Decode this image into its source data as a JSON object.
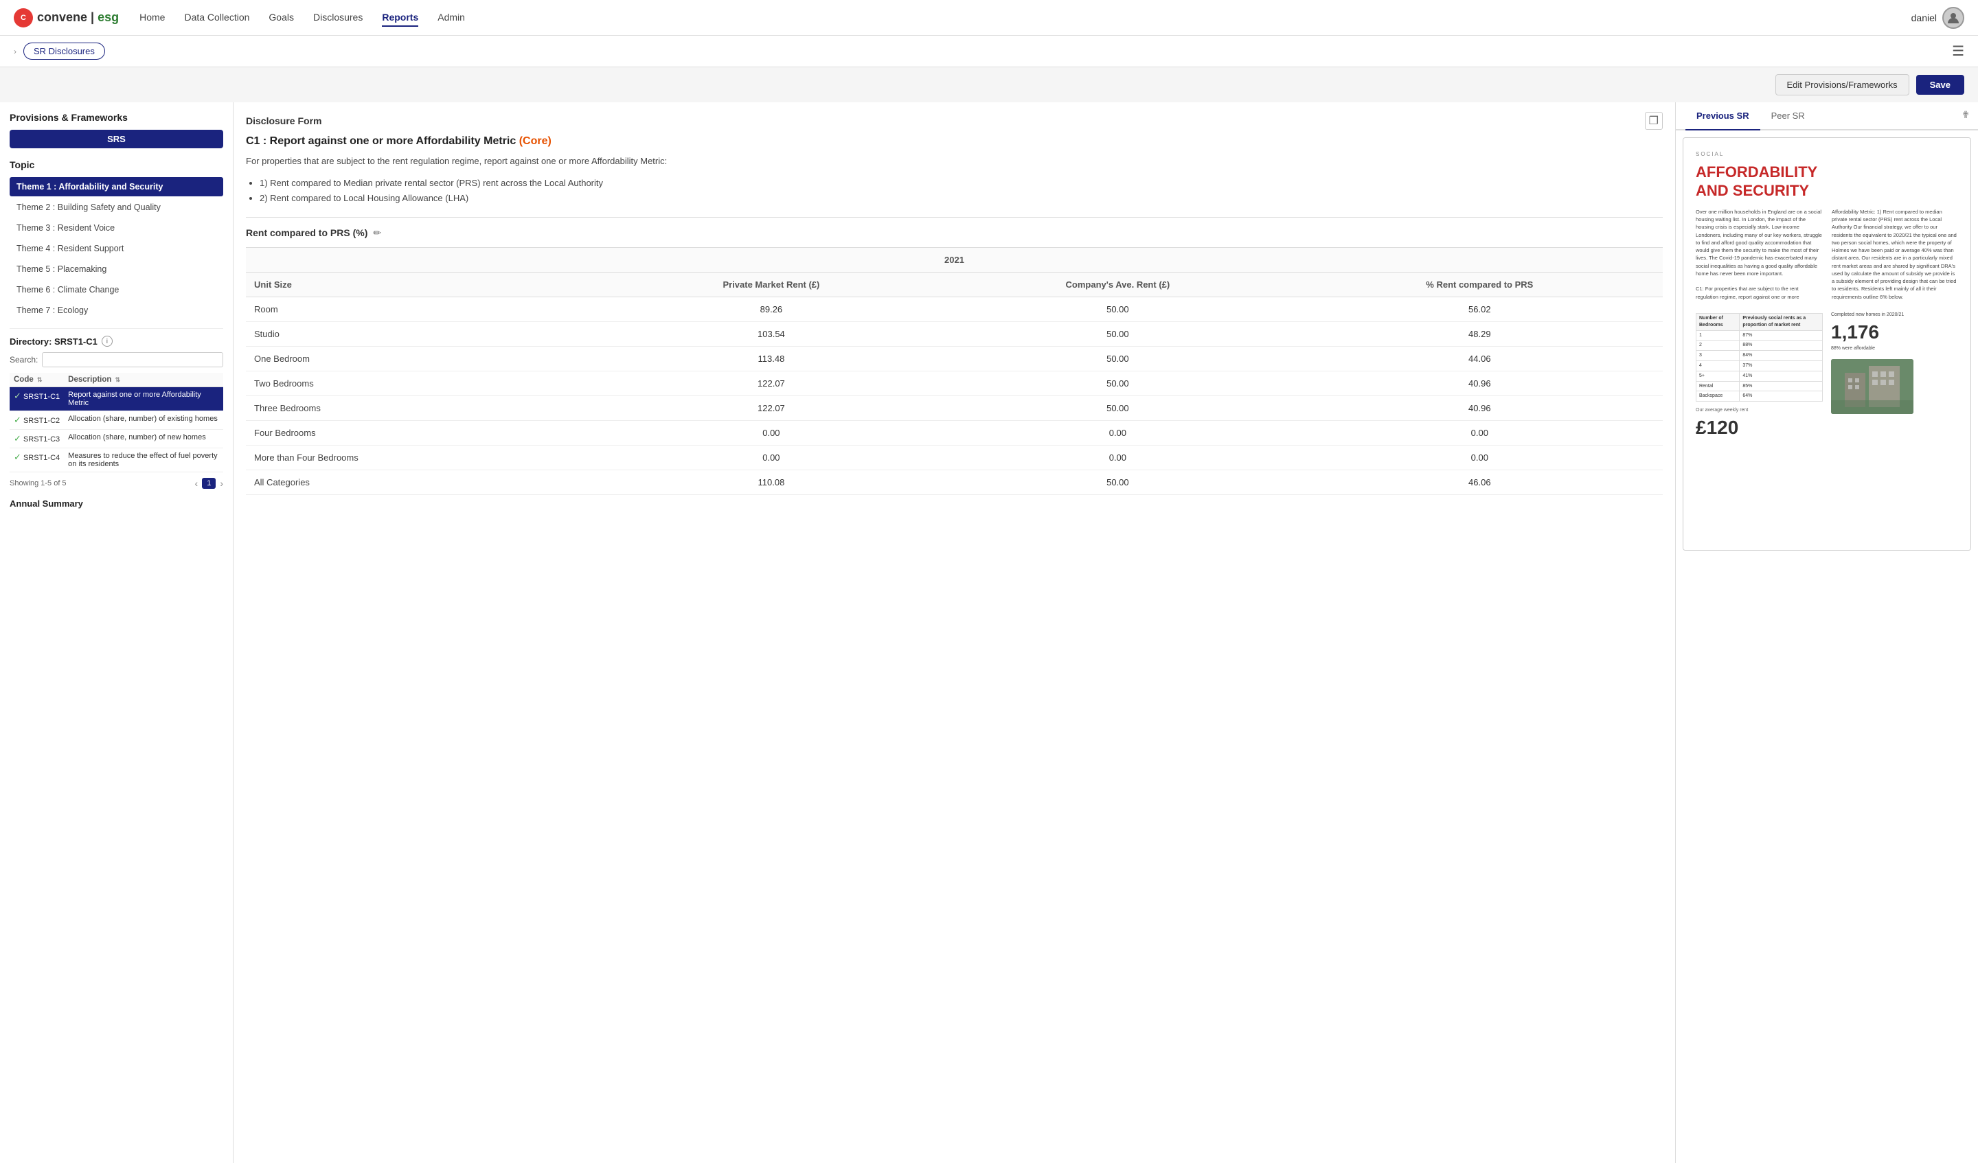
{
  "navbar": {
    "logo_brand": "convene",
    "logo_esg": "esg",
    "links": [
      "Home",
      "Data Collection",
      "Goals",
      "Disclosures",
      "Reports",
      "Admin"
    ],
    "active_link": "Reports",
    "user_name": "daniel"
  },
  "breadcrumb": {
    "label": "SR Disclosures"
  },
  "actions": {
    "edit_label": "Edit Provisions/Frameworks",
    "save_label": "Save"
  },
  "left_panel": {
    "provisions_title": "Provisions & Frameworks",
    "framework_badge": "SRS",
    "topic_title": "Topic",
    "topics": [
      {
        "label": "Theme 1 : Affordability and Security",
        "active": true
      },
      {
        "label": "Theme 2 : Building Safety and Quality",
        "active": false
      },
      {
        "label": "Theme 3 : Resident Voice",
        "active": false
      },
      {
        "label": "Theme 4 : Resident Support",
        "active": false
      },
      {
        "label": "Theme 5 : Placemaking",
        "active": false
      },
      {
        "label": "Theme 6 : Climate Change",
        "active": false
      },
      {
        "label": "Theme 7 : Ecology",
        "active": false
      }
    ],
    "directory_title": "Directory: SRST1-C1",
    "search_label": "Search:",
    "search_placeholder": "",
    "dir_col_code": "Code",
    "dir_col_desc": "Description",
    "dir_rows": [
      {
        "code": "SRST1-C1",
        "desc": "Report against one or more Affordability Metric",
        "active": true
      },
      {
        "code": "SRST1-C2",
        "desc": "Allocation (share, number) of existing homes",
        "active": false
      },
      {
        "code": "SRST1-C3",
        "desc": "Allocation (share, number) of new homes",
        "active": false
      },
      {
        "code": "SRST1-C4",
        "desc": "Measures to reduce the effect of fuel poverty on its residents",
        "active": false
      }
    ],
    "pagination_text": "Showing 1-5 of 5",
    "page_num": "1",
    "annual_summary": "Annual Summary"
  },
  "center_panel": {
    "form_title": "Disclosure Form",
    "metric_code": "C1 : Report against one or more Affordability Metric",
    "metric_core_label": "(Core)",
    "description": "For properties that are subject to the rent regulation regime, report against one or more Affordability Metric:",
    "bullets": [
      "1) Rent compared to Median private rental sector (PRS) rent across the Local Authority",
      "2) Rent compared to Local Housing Allowance (LHA)"
    ],
    "section_title": "Rent compared to PRS (%)",
    "year_header": "2021",
    "table_cols": [
      "Unit Size",
      "Private Market Rent (£)",
      "Company's Ave. Rent (£)",
      "% Rent compared to PRS"
    ],
    "table_rows": [
      {
        "unit": "Room",
        "pmr": "89.26",
        "car": "50.00",
        "pct": "56.02"
      },
      {
        "unit": "Studio",
        "pmr": "103.54",
        "car": "50.00",
        "pct": "48.29"
      },
      {
        "unit": "One Bedroom",
        "pmr": "113.48",
        "car": "50.00",
        "pct": "44.06"
      },
      {
        "unit": "Two Bedrooms",
        "pmr": "122.07",
        "car": "50.00",
        "pct": "40.96"
      },
      {
        "unit": "Three Bedrooms",
        "pmr": "122.07",
        "car": "50.00",
        "pct": "40.96"
      },
      {
        "unit": "Four Bedrooms",
        "pmr": "0.00",
        "car": "0.00",
        "pct": "0.00"
      },
      {
        "unit": "More than Four Bedrooms",
        "pmr": "0.00",
        "car": "0.00",
        "pct": "0.00"
      },
      {
        "unit": "All Categories",
        "pmr": "110.08",
        "car": "50.00",
        "pct": "46.06"
      }
    ]
  },
  "right_panel": {
    "tab_previous": "Previous SR",
    "tab_peer": "Peer SR",
    "active_tab": "Previous SR",
    "doc_social_label": "SOCIAL",
    "doc_heading_line1": "AFFORDABILITY",
    "doc_heading_line2": "AND SECURITY",
    "doc_body_text": "Over one million households in England are on a social housing waiting list. In London, the impact of the housing crisis is especially stark. Low-income Londoners, including many of our key workers, struggle to find and afford good quality accommodation that would give them the security to make the most of their lives. The Covid-19 pandemic has exacerbated many social inequalities as having a good quality affordable home has never been more important.",
    "doc_body_text2": "C1: For properties that are subject to the rent regulation regime, report against one or more Affordability Metric: 1) Rent compared to median private rental sector (PRS) rent across the Local Authority Our financial strategy, we offer to our residents the equivalent to 2020/21 the typical one and two person social homes, which were the property of Holmes we have been paid or average 40% was than distant area. Our residents are in a particularly mixed rent market areas and are shared by significant DRA's used by calculate the amount of subsidy we provide is a subsidy element of providing design that can be tried to residents. Residents left mainly of all it their requirements outline 6% below.",
    "doc_weekly_label": "Our average weekly rent",
    "doc_weekly_amount": "£120",
    "doc_table_header1": "Number of Bedrooms",
    "doc_table_header2": "Previously social rents as a proportion of market rent",
    "doc_completed_label": "Completed new homes in 2020/21",
    "doc_big_number": "1,176",
    "doc_affordable_pct": "88% were affordable"
  }
}
